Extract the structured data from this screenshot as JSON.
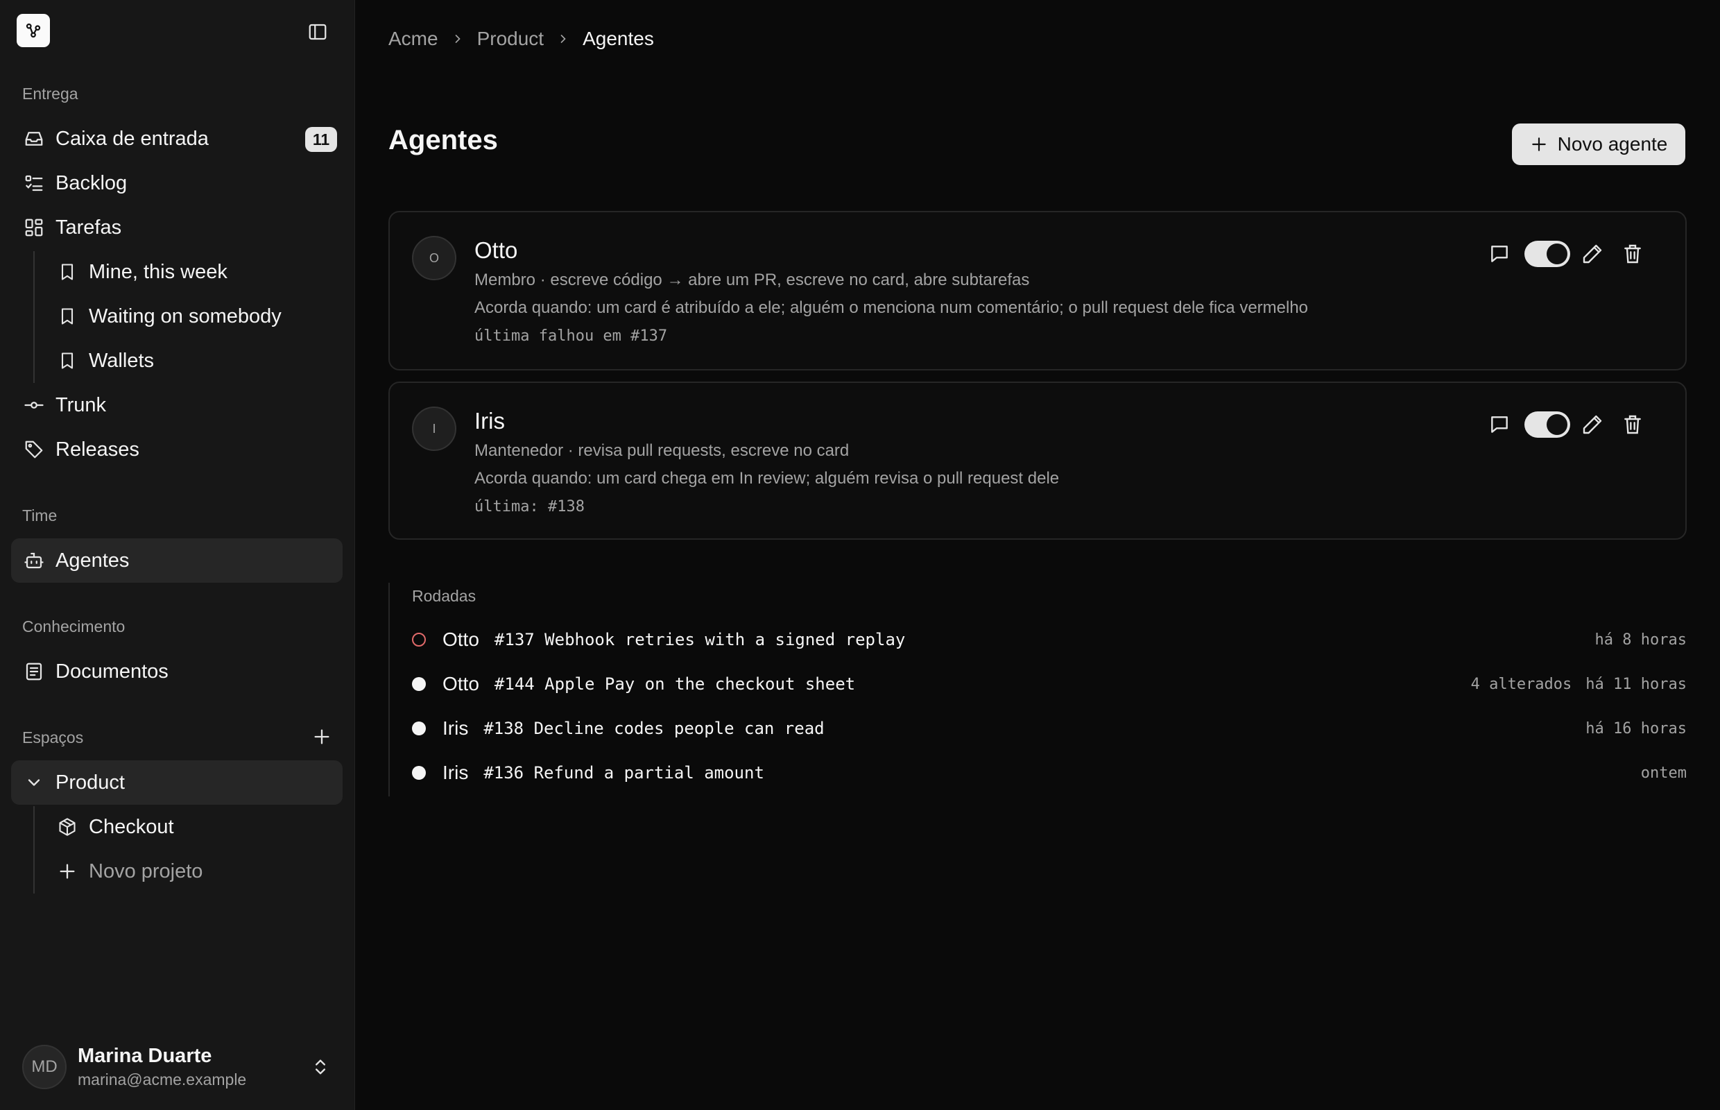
{
  "sidebar": {
    "sections": {
      "delivery": "Entrega",
      "team": "Time",
      "knowledge": "Conhecimento",
      "spaces": "Espaços"
    },
    "inbox": {
      "label": "Caixa de entrada",
      "count": "11"
    },
    "backlog": "Backlog",
    "tasks": "Tarefas",
    "saved_views": [
      "Mine, this week",
      "Waiting on somebody",
      "Wallets"
    ],
    "trunk": "Trunk",
    "releases": "Releases",
    "agents": "Agentes",
    "documents": "Documentos",
    "space": "Product",
    "project": "Checkout",
    "new_project": "Novo projeto",
    "user": {
      "initials": "MD",
      "name": "Marina Duarte",
      "email": "marina@acme.example"
    }
  },
  "breadcrumb": [
    "Acme",
    "Product",
    "Agentes"
  ],
  "page": {
    "title": "Agentes",
    "new_button": "Novo agente"
  },
  "agents": [
    {
      "initial": "O",
      "name": "Otto",
      "role": "Membro · escreve código → abre um PR, escreve no card, abre subtarefas",
      "wake": "Acorda quando: um card é atribuído a ele; alguém o menciona num comentário; o pull request dele fica vermelho",
      "last": "última falhou em #137",
      "enabled": true
    },
    {
      "initial": "I",
      "name": "Iris",
      "role": "Mantenedor · revisa pull requests, escreve no card",
      "wake": "Acorda quando: um card chega em In review; alguém revisa o pull request dele",
      "last": "última: #138",
      "enabled": true
    }
  ],
  "runs": {
    "title": "Rodadas",
    "items": [
      {
        "agent": "Otto",
        "task": "#137 Webhook retries with a signed replay",
        "changed": "",
        "time": "há 8 horas",
        "status": "failed"
      },
      {
        "agent": "Otto",
        "task": "#144 Apple Pay on the checkout sheet",
        "changed": "4 alterados",
        "time": "há 11 horas",
        "status": "done"
      },
      {
        "agent": "Iris",
        "task": "#138 Decline codes people can read",
        "changed": "",
        "time": "há 16 horas",
        "status": "done"
      },
      {
        "agent": "Iris",
        "task": "#136 Refund a partial amount",
        "changed": "",
        "time": "ontem",
        "status": "done"
      }
    ]
  },
  "colors": {
    "background": "#0a0a0a",
    "sidebar": "#171717",
    "failed": "#e06a6a"
  }
}
